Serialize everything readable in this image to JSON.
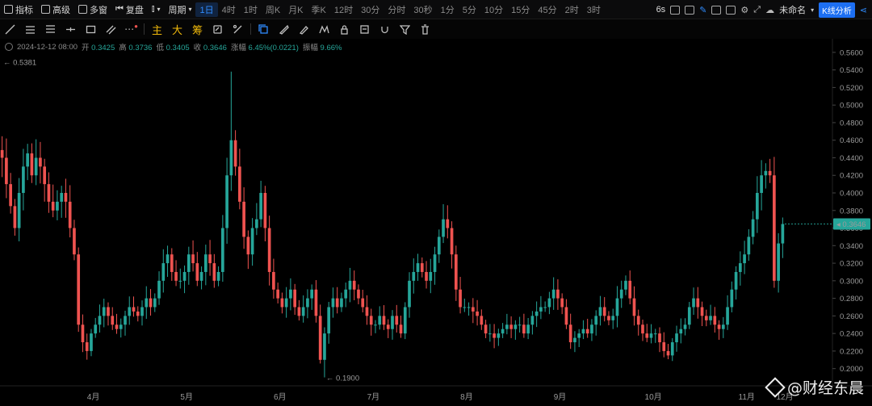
{
  "toolbar": {
    "indicators": "指标",
    "advanced": "高级",
    "multi_window": "多窗",
    "replay": "复盘",
    "period_label": "周期",
    "periods": [
      "1日",
      "4时",
      "1时",
      "周K",
      "月K",
      "季K",
      "12时",
      "30分",
      "分时",
      "30秒",
      "1分",
      "5分",
      "10分",
      "15分",
      "45分",
      "2时",
      "3时"
    ],
    "active_period": "1日",
    "refresh": "6s",
    "layout_name": "未命名",
    "kline_button": "K线分析"
  },
  "drawing_tools": {
    "main": "主",
    "big": "大",
    "chip": "筹"
  },
  "ohlc": {
    "date": "2024-12-12 08:00",
    "open_label": "开",
    "open": "0.3425",
    "high_label": "高",
    "high": "0.3736",
    "low_label": "低",
    "low": "0.3405",
    "close_label": "收",
    "close": "0.3646",
    "change_label": "涨幅",
    "change": "6.45%(0.0221)",
    "amplitude_label": "振幅",
    "amplitude": "9.66%"
  },
  "annotations": {
    "max_label": "← 0.5381",
    "min_label": "← 0.1900"
  },
  "colors": {
    "up": "#26a69a",
    "down": "#ef5350",
    "price_tag": "#26a69a",
    "accent": "#2f8cff"
  },
  "watermark": "@财经东晨",
  "chart_data": {
    "type": "candlestick",
    "x_ticks": [
      "4月",
      "5月",
      "6月",
      "7月",
      "8月",
      "9月",
      "10月",
      "11月",
      "12月"
    ],
    "y_ticks": [
      "0.5600",
      "0.5400",
      "0.5200",
      "0.5000",
      "0.4800",
      "0.4600",
      "0.4400",
      "0.4200",
      "0.4000",
      "0.3800",
      "0.3600",
      "0.3400",
      "0.3200",
      "0.3000",
      "0.2800",
      "0.2600",
      "0.2400",
      "0.2200",
      "0.2000"
    ],
    "ylim": [
      0.185,
      0.57
    ],
    "last_price": "0.3646",
    "max_price": 0.5381,
    "min_price": 0.19,
    "closes_by_period": [
      [
        0.44,
        0.41,
        0.385,
        0.36,
        0.4,
        0.43,
        0.445,
        0.42,
        0.44,
        0.43,
        0.41,
        0.39,
        0.38,
        0.39,
        0.4,
        0.39,
        0.36,
        0.33,
        0.25,
        0.23,
        0.22,
        0.24
      ],
      [
        0.25,
        0.26,
        0.27,
        0.26,
        0.25,
        0.245,
        0.25,
        0.26,
        0.27,
        0.265,
        0.26,
        0.27,
        0.28,
        0.27,
        0.28,
        0.3,
        0.32,
        0.33,
        0.31,
        0.3,
        0.3,
        0.31
      ],
      [
        0.33,
        0.32,
        0.3,
        0.31,
        0.33,
        0.32,
        0.3,
        0.31,
        0.36,
        0.42,
        0.46,
        0.43,
        0.39,
        0.35,
        0.33,
        0.36,
        0.37,
        0.4,
        0.36,
        0.31,
        0.29,
        0.28
      ],
      [
        0.27,
        0.28,
        0.29,
        0.27,
        0.26,
        0.27,
        0.28,
        0.29,
        0.26,
        0.21,
        0.24,
        0.27,
        0.28,
        0.27,
        0.28,
        0.29,
        0.3,
        0.29,
        0.28,
        0.27,
        0.26,
        0.25
      ],
      [
        0.25,
        0.26,
        0.25,
        0.245,
        0.26,
        0.25,
        0.24,
        0.27,
        0.3,
        0.31,
        0.32,
        0.31,
        0.3,
        0.31,
        0.33,
        0.35,
        0.37,
        0.36,
        0.33,
        0.29,
        0.27,
        0.27
      ],
      [
        0.27,
        0.265,
        0.26,
        0.25,
        0.24,
        0.24,
        0.235,
        0.24,
        0.245,
        0.25,
        0.245,
        0.25,
        0.25,
        0.24,
        0.25,
        0.26,
        0.265,
        0.27,
        0.27,
        0.28,
        0.29,
        0.28
      ],
      [
        0.27,
        0.25,
        0.23,
        0.235,
        0.24,
        0.245,
        0.24,
        0.25,
        0.26,
        0.27,
        0.26,
        0.255,
        0.26,
        0.28,
        0.29,
        0.3,
        0.28,
        0.26,
        0.25,
        0.24,
        0.235,
        0.24
      ],
      [
        0.24,
        0.23,
        0.22,
        0.215,
        0.23,
        0.24,
        0.245,
        0.25,
        0.27,
        0.28,
        0.27,
        0.26,
        0.255,
        0.26,
        0.25,
        0.245,
        0.25,
        0.27,
        0.29,
        0.31,
        0.32,
        0.33
      ],
      [
        0.35,
        0.37,
        0.4,
        0.42,
        0.425,
        0.42,
        0.3,
        0.3425,
        0.3646
      ]
    ]
  }
}
